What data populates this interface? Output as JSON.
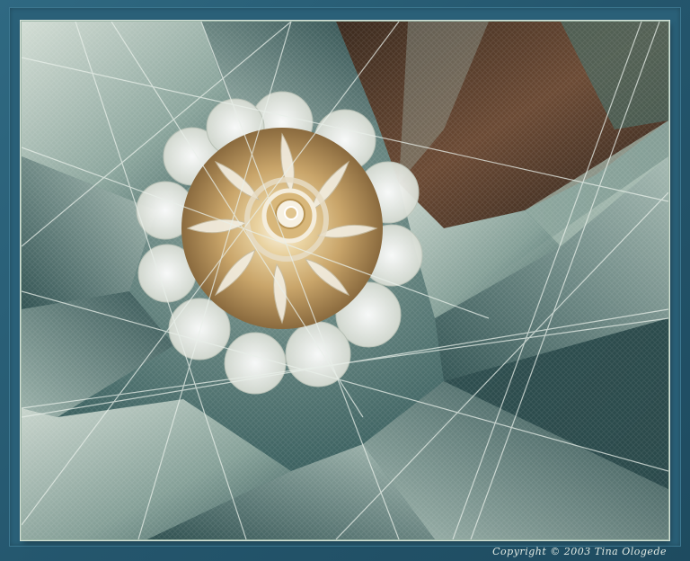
{
  "image": {
    "alt": "Abstract fractal artwork: a cream and gold spiral blossom surrounded by sharp teal glass-like shards with fine crossing lines",
    "caption": "Copyright © 2003 Tina Ologede"
  },
  "colors": {
    "frame": "#2b5f78",
    "shard_light": "#c9d6cc",
    "shard_mid": "#7f9c94",
    "shard_dark": "#254a4c",
    "bloom_gold": "#c8a56a",
    "bloom_cream": "#efe9da",
    "rust": "#6b3a22"
  }
}
